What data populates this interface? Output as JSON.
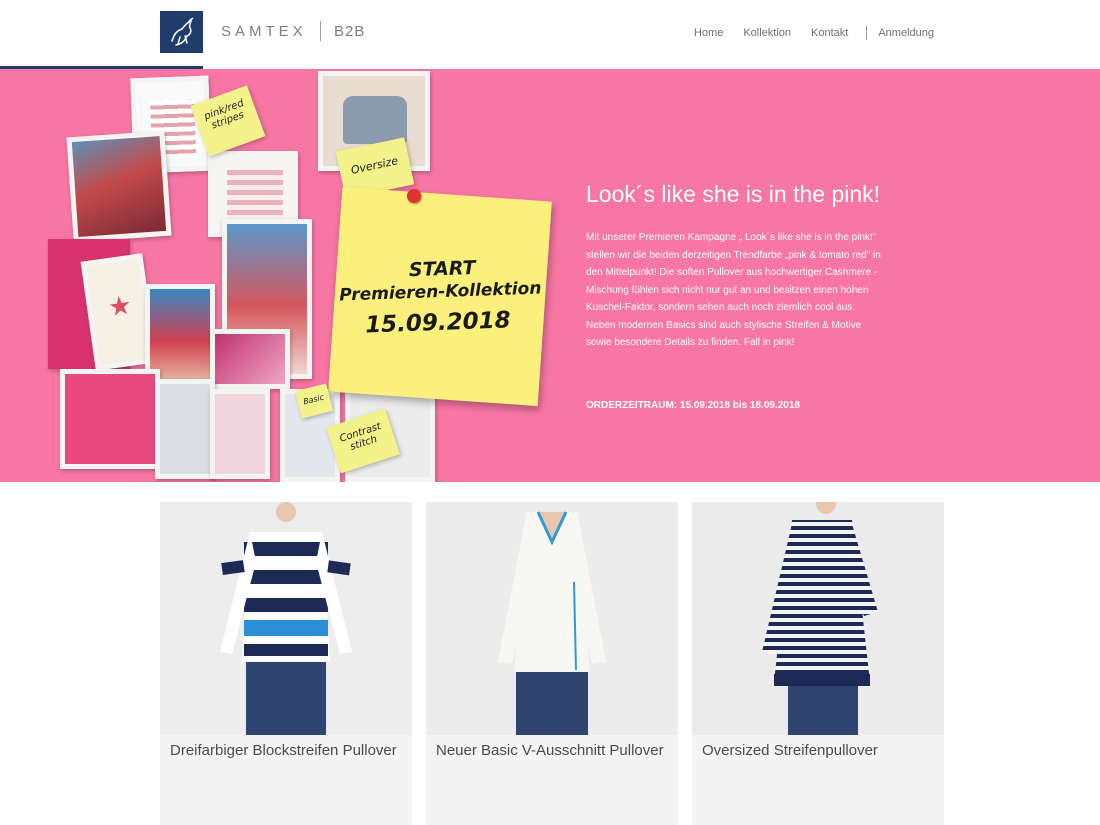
{
  "header": {
    "logo_icon": "horse-logo-icon",
    "brand_name": "SAMTEX",
    "brand_suffix": "B2B",
    "nav": [
      "Home",
      "Kollektion",
      "Kontakt",
      "Anmeldung"
    ],
    "accent_color": "#1f3c6b"
  },
  "hero": {
    "background_color": "#f876a4",
    "collage_notes": {
      "stripes": "pink/red stripes",
      "oversize": "Oversize",
      "big_note_line1": "START",
      "big_note_line2": "Premieren-Kollektion",
      "big_note_line3": "15.09.2018",
      "basic": "Basic",
      "kontrast": "Contrast stitch"
    },
    "title": "Look´s like she is in the pink!",
    "body": "Mit unserer Premieren Kampagne „ Look´s like she is in the pink!\" stellen wir die beiden derzeitigen Trendfarbe „pink & tomato red\" in den Mittelpunkt! Die soften Pullover aus hochwertiger Cashmere -Mischung fühlen sich nicht nur gut an und besitzen einen hohen Kuschel-Faktor, sondern sehen auch noch ziemlich cool aus: Neben modernen Basics sind auch stylische Streifen & Motive sowie besondere Details zu finden. Fall in pink!",
    "order_period": "ORDERZEITRAUM: 15.09.2018 bis 18.09.2018"
  },
  "products": [
    {
      "title": "Dreifarbiger Blockstreifen Pullover"
    },
    {
      "title": "Neuer Basic V-Ausschnitt Pullover"
    },
    {
      "title": "Oversized Streifenpullover"
    }
  ]
}
